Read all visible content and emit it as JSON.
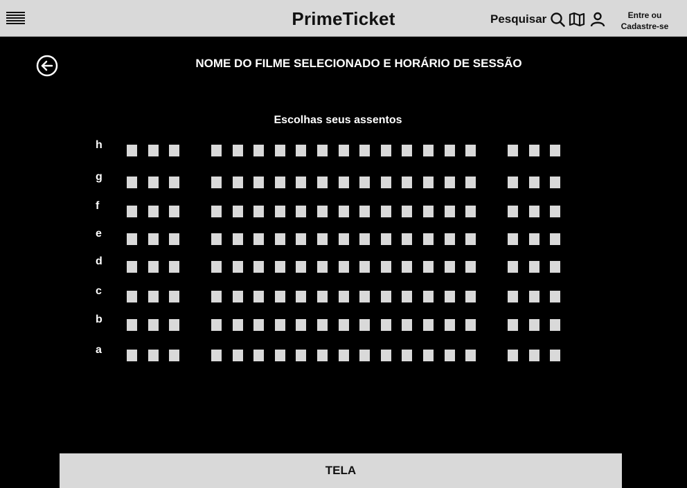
{
  "header": {
    "brand": "PrimeTicket",
    "search_label": "Pesquisar",
    "login_line1": "Entre ou",
    "login_line2": "Cadastre-se"
  },
  "page": {
    "title": "NOME DO FILME SELECIONADO E HORÁRIO DE SESSÃO",
    "subtitle": "Escolhas seus assentos"
  },
  "seatmap": {
    "rows": [
      "h",
      "g",
      "f",
      "e",
      "d",
      "c",
      "b",
      "a"
    ],
    "sections": [
      3,
      13,
      3
    ],
    "seat_color": "#d9d9d9"
  },
  "screen": {
    "label": "TELA"
  }
}
